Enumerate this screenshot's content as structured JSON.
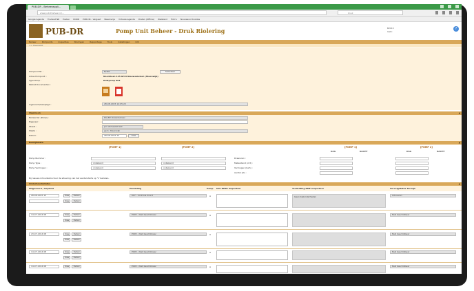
{
  "browser": {
    "tab_title": "PUB-DR - Beheerappli...",
    "url": "www.pubdrbeheer.nl/...",
    "search_placeholder": "Zoek",
    "bookmarks": [
      "Google Agenda",
      "Fredwet NR",
      "Posten",
      "DORR",
      "PUB-DR - Vergeet",
      "Weersvrije",
      "Virtuele agenda",
      "Posten (Offline)",
      "Welstand",
      "Foto's",
      "Nouveaux Doubles"
    ]
  },
  "header": {
    "logo_text": "PUB-DR",
    "title": "Pomp Unit Beheer - Druk Riolering",
    "info_line1": "B2015",
    "info_line2": "Gebr."
  },
  "menu": [
    "Beheer",
    "Pompunits",
    "Inspecties",
    "Storingen",
    "Rapportage",
    "Tools",
    "Instellingen",
    "Info"
  ],
  "submenu": "<< Overzicht",
  "registratie": {
    "pompunit_label": "Pompunit Nr. :",
    "pompunit_value": "B/361",
    "select_label": "Selecteer",
    "adres_label": "Adres Pompunit :",
    "adres_value": "Noordlaan 125 GH 8 Nieuwesluizen (Steenwijk)",
    "type_label": "Type Pomp :",
    "type_value": "Duikpomp 003",
    "docs_label": "Pakket Documenten :",
    "ingevoerd_label": "Ingevoerd/Gewijzigd :",
    "ingevoerd_value": "28-08-2015 14:05:22"
  },
  "algemeen": {
    "section": "Algemeen",
    "beheerder_label": "Beheerder (Pomp) :",
    "beheerder_value": "RIA-BV Riolenbeheer",
    "eigenaar_label": "Eigenaar :",
    "straat_label": "Straat :",
    "straat_value": "Jan Verbeekstraat",
    "plaats_label": "Plaats :",
    "plaats_value": "gem. Steenwijk",
    "datum_label": "Datum :",
    "datum_value": "28-08-2015 14",
    "datum_btn": "Kies"
  },
  "bedrijfsdata": {
    "section": "Bedrijfsdata",
    "col1": "[POMP 1]",
    "col2": "[POMP 2]",
    "col3": "[POMP 1]",
    "col4": "[POMP 2]",
    "dag": "DAG",
    "nacht": "NACHT",
    "r1_label": "Pomp Nummer :",
    "r2_label": "Pomp Type :",
    "r3_label": "Pomp Vermogen :",
    "r2_val": "onbekend",
    "r3_val": "onbekend",
    "rr1": "Draaiuren :",
    "rr2": "Meterstand (m3) :",
    "rr3": "Vermogen (kwh) :",
    "rr4": "Aantal (st) :",
    "note": "Bij nieuwe inhoudsstructuur de situering van het aantal starts op 'V' behalen."
  },
  "onderhoud": {
    "section": "Onderhoudsstatus",
    "h_date": "Uitgevoerd / Gepland",
    "h_handeling": "Handeling",
    "h_pomp": "Pomp",
    "h_info": "Info DESK inspecteur",
    "h_afwijking": "Toelichting DMF inspecteur",
    "h_status": "Vervolgstatus Termijn",
    "btn_kies": "Kies",
    "btn_detail": "Detail",
    "rows": [
      {
        "date": "28-08-2015 15",
        "handeling": "007 - Controle direct",
        "pomp": "A",
        "afwijking": "Geen bijzonderheden",
        "status": "Uitvoeren"
      },
      {
        "date": "14-07-2014 08",
        "handeling": "P005 - Niet beschikbaar",
        "pomp": "A",
        "afwijking": "",
        "status": "Niet beschikbaar"
      },
      {
        "date": "23-07-2014 08",
        "handeling": "P005 - Niet beschikbaar",
        "pomp": "A",
        "afwijking": "",
        "status": "Niet beschikbaar"
      },
      {
        "date": "14-07-2014 08",
        "handeling": "P005 - Niet beschikbaar",
        "pomp": "A",
        "afwijking": "",
        "status": "Niet beschikbaar"
      },
      {
        "date": "14-07-2014 08",
        "handeling": "P005 - Niet beschikbaar",
        "pomp": "A",
        "afwijking": "",
        "status": "Niet beschikbaar"
      }
    ]
  }
}
